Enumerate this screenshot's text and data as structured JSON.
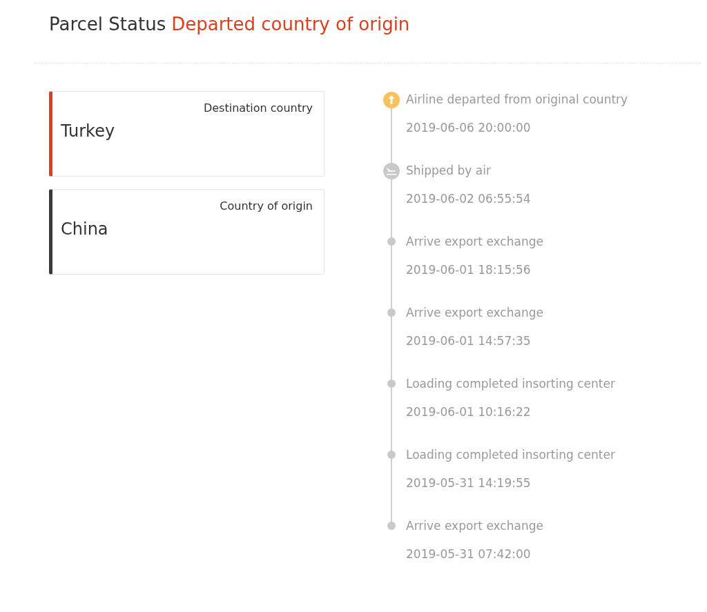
{
  "header": {
    "label": "Parcel Status",
    "status": "Departed country of origin"
  },
  "countries": [
    {
      "label": "Destination country",
      "name": "Turkey",
      "color": "#d9401e"
    },
    {
      "label": "Country of origin",
      "name": "China",
      "color": "#3a3a3a"
    }
  ],
  "events": [
    {
      "kind": "current",
      "title": "Airline departed from original country",
      "time": "2019-06-06 20:00:00"
    },
    {
      "kind": "flight",
      "title": "Shipped by air",
      "time": "2019-06-02 06:55:54"
    },
    {
      "kind": "point",
      "title": "Arrive export exchange",
      "time": "2019-06-01 18:15:56"
    },
    {
      "kind": "point",
      "title": "Arrive export exchange",
      "time": "2019-06-01 14:57:35"
    },
    {
      "kind": "point",
      "title": "Loading completed insorting center",
      "time": "2019-06-01 10:16:22"
    },
    {
      "kind": "point",
      "title": "Loading completed insorting center",
      "time": "2019-05-31 14:19:55"
    },
    {
      "kind": "point",
      "title": "Arrive export exchange",
      "time": "2019-05-31 07:42:00"
    }
  ]
}
